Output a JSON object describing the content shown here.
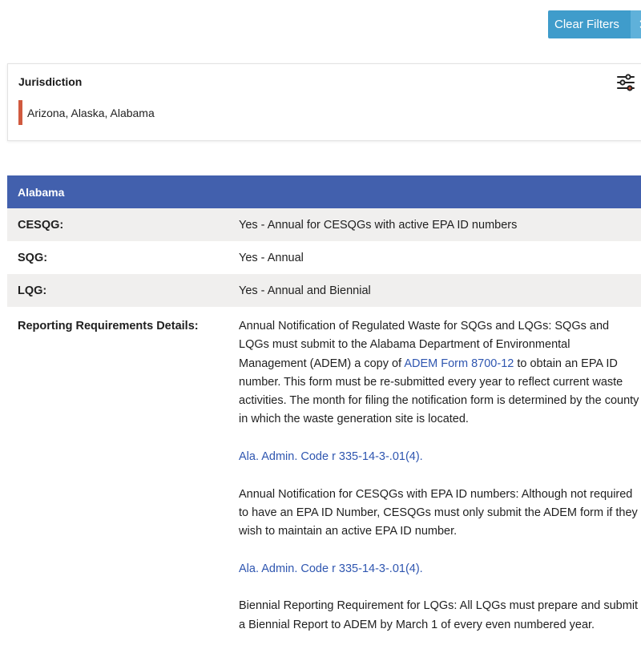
{
  "toolbar": {
    "clear_filters_label": "Clear Filters",
    "clear_filters_close": "✕"
  },
  "jurisdiction": {
    "title": "Jurisdiction",
    "selected": "Arizona, Alaska, Alabama",
    "filter_icon": "sliders-icon",
    "filter_icon_colors": {
      "line": "#222222",
      "accent": "#d05a3f"
    }
  },
  "state": {
    "name": "Alabama",
    "header_color": "#4260ad",
    "rows": [
      {
        "label": "CESQG:",
        "value": "Yes - Annual for CESQGs with active EPA ID numbers"
      },
      {
        "label": "SQG:",
        "value": "Yes - Annual"
      },
      {
        "label": "LQG:",
        "value": "Yes - Annual and Biennial"
      }
    ],
    "details": {
      "label": "Reporting Requirements Details:",
      "p1_before": "Annual Notification of Regulated Waste for SQGs and LQGs: SQGs and LQGs must submit to the Alabama Department of Environmental Management (ADEM) a copy of ",
      "p1_link": "ADEM Form 8700-12",
      "p1_after": " to obtain an EPA ID number.  This form must be re-submitted every year to reflect current waste activities.  The month for filing the notification form is determined by the county in which the waste generation site is located.",
      "cite1": "Ala. Admin. Code r 335-14-3-.01(4).",
      "p2": "Annual Notification for CESQGs with EPA ID numbers:  Although not required to have an EPA ID Number, CESQGs must only submit the ADEM form if they wish to maintain an active EPA ID number.",
      "cite2": "Ala. Admin. Code r 335-14-3-.01(4).",
      "p3": "Biennial Reporting Requirement for LQGs:  All LQGs must prepare and submit a Biennial Report to ADEM by March 1 of every even numbered year."
    }
  }
}
